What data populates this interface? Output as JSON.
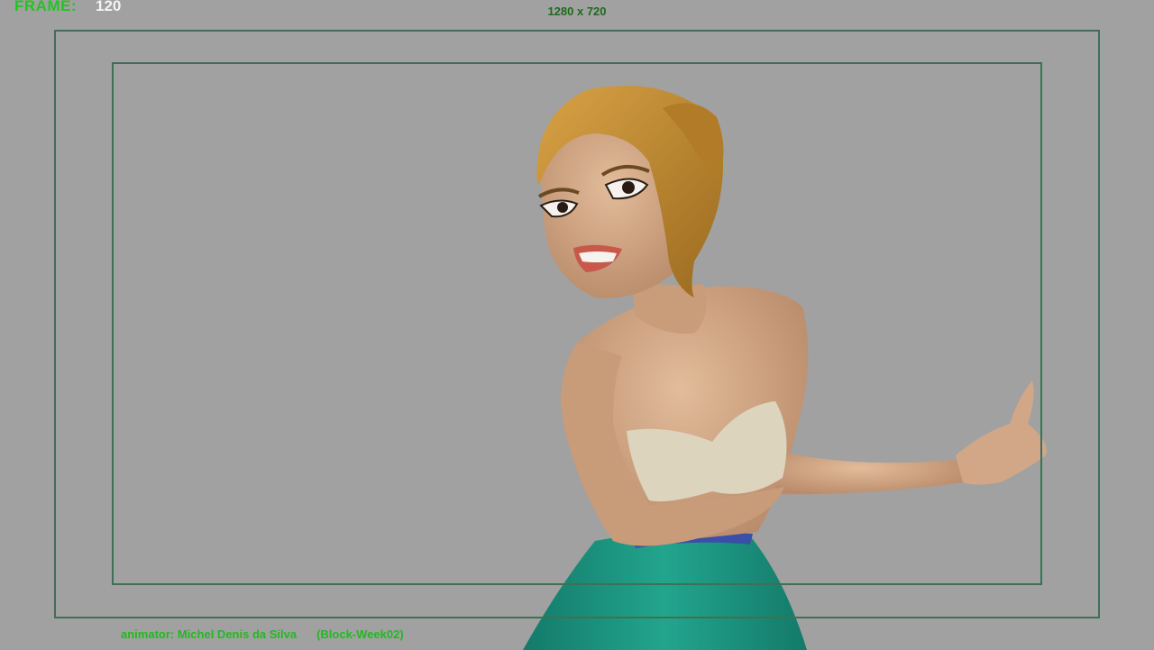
{
  "viewport": {
    "frame_label": "FRAME:",
    "frame_value": "120",
    "resolution_label": "1280 x 720",
    "animator_label": "animator:",
    "animator_name": "Michel Denis da Silva",
    "animator_tag": "(Block-Week02)"
  },
  "colors": {
    "background": "#a1a1a1",
    "hud_green": "#23c423",
    "guide_line": "#3f6f55",
    "skin": "#d6ad8c",
    "hair": "#c08a2c",
    "top": "#ddd4bd",
    "skirt": "#1e9a84"
  }
}
